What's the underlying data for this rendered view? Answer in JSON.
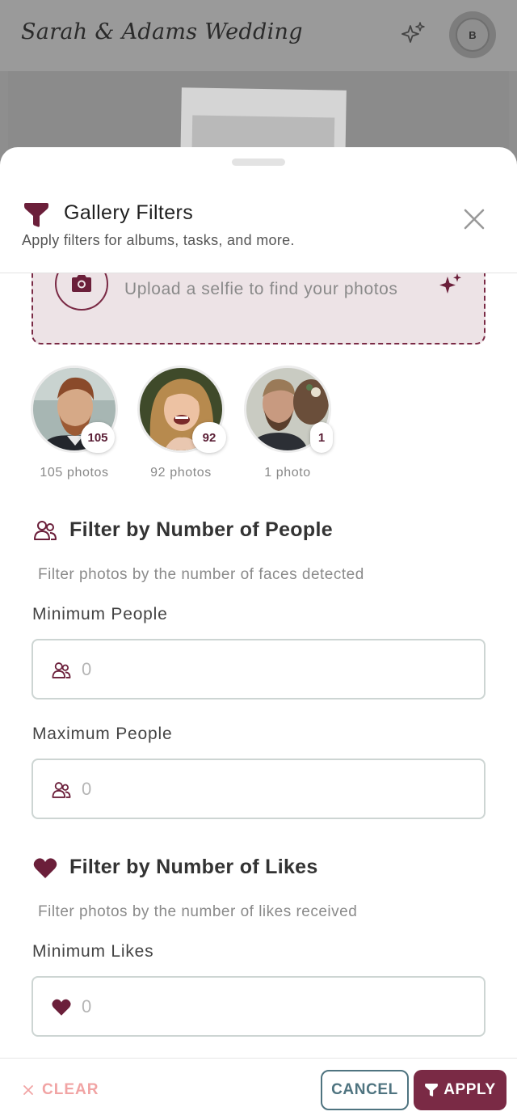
{
  "app": {
    "title": "Sarah & Adams Wedding",
    "avatar_initial": "B"
  },
  "sheet": {
    "title": "Gallery Filters",
    "subtitle": "Apply filters for albums, tasks, and more."
  },
  "upload": {
    "text": "Upload a selfie to find your photos"
  },
  "faces": [
    {
      "count": "105",
      "label": "105 photos"
    },
    {
      "count": "92",
      "label": "92 photos"
    },
    {
      "count": "1",
      "label": "1 photo"
    }
  ],
  "people_filter": {
    "title": "Filter by Number of People",
    "description": "Filter photos by the number of faces detected",
    "min_label": "Minimum People",
    "min_placeholder": "0",
    "max_label": "Maximum People",
    "max_placeholder": "0"
  },
  "likes_filter": {
    "title": "Filter by Number of Likes",
    "description": "Filter photos by the number of likes received",
    "min_label": "Minimum Likes",
    "min_placeholder": "0"
  },
  "footer": {
    "clear_label": "CLEAR",
    "cancel_label": "CANCEL",
    "apply_label": "APPLY"
  },
  "colors": {
    "accent": "#7a2a45",
    "clear": "#f1a4a4",
    "cancel": "#4f7480"
  },
  "icons": [
    "sparkle-icon",
    "funnel-icon",
    "close-icon",
    "camera-icon",
    "people-icon",
    "heart-icon",
    "x-icon"
  ]
}
